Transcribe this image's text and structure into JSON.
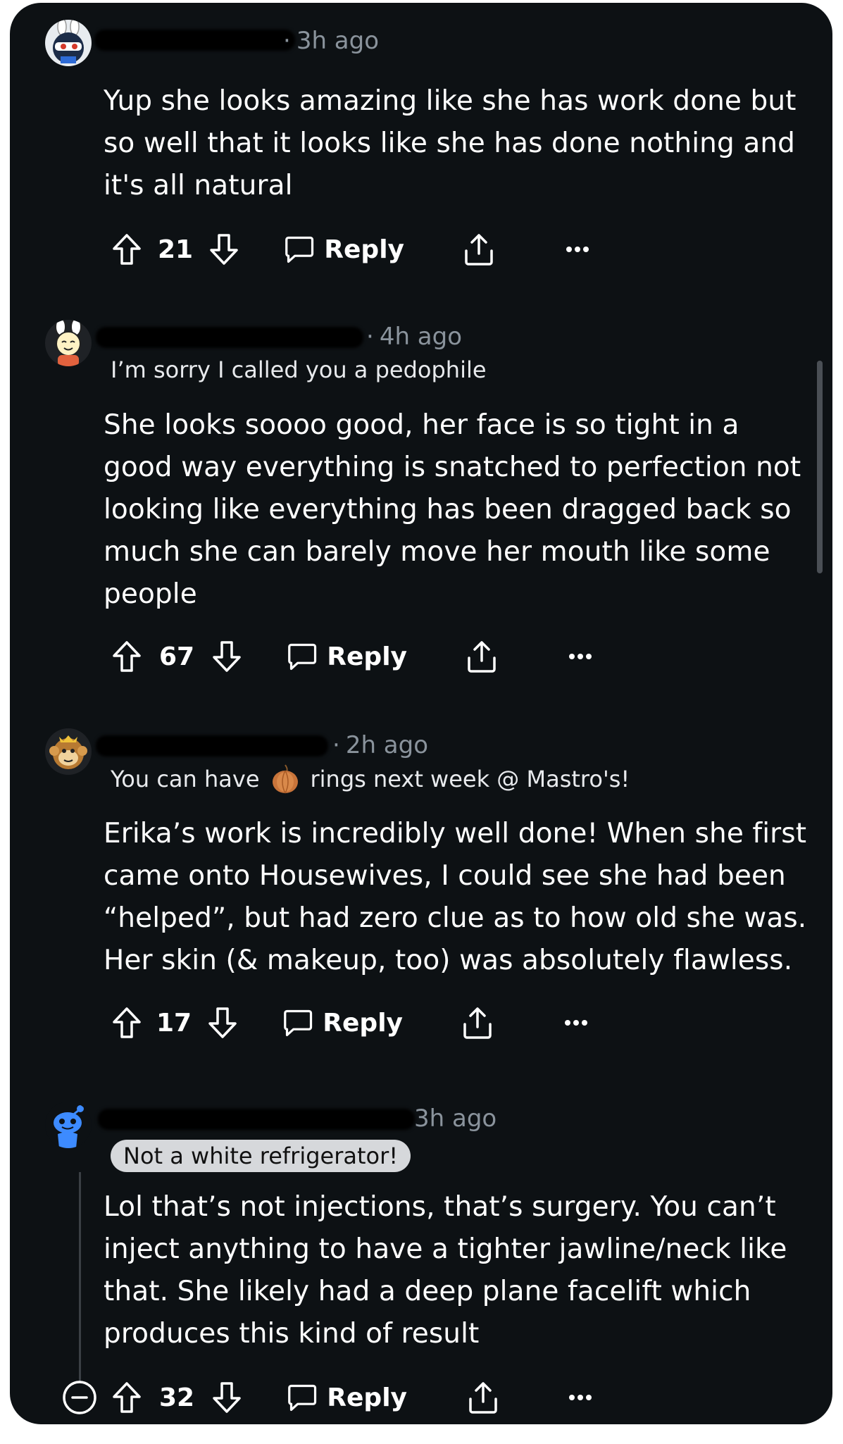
{
  "colors": {
    "background": "#0d1114",
    "text": "#ffffff",
    "meta": "#8a939c",
    "flair_pill_bg": "#d6d8db"
  },
  "comments": [
    {
      "time": "3h ago",
      "flair": "",
      "body": "Yup she looks amazing like she has work done but so well that it looks like she has done nothing and it's all natural",
      "votes": "21",
      "reply_label": "Reply",
      "avatar_icon": "bunny-helmet-avatar"
    },
    {
      "time": "4h ago",
      "flair": "I’m sorry I called you a pedophile",
      "body": "She looks soooo good, her face is so tight in a good way everything is snatched to perfection not looking like everything has been dragged back so much she can barely move her mouth like some people",
      "votes": "67",
      "reply_label": "Reply",
      "avatar_icon": "bunny-ears-avatar"
    },
    {
      "time": "2h ago",
      "flair_before": "You can have",
      "flair_icon": "onion-icon",
      "flair_after": "rings next week @ Mastro's!",
      "body": "Erika’s work is incredibly well done! When she first came onto Housewives, I could see she had been “helped”, but had zero clue as to how old she was. Her skin (& makeup, too) was absolutely flawless.",
      "votes": "17",
      "reply_label": "Reply",
      "avatar_icon": "monkey-avatar"
    },
    {
      "time": "3h ago",
      "flair": "Not a white refrigerator!",
      "body": "Lol that’s not injections, that’s surgery. You can’t inject anything to have a tighter jawline/neck like that. She likely had a deep plane facelift which produces this kind of result",
      "votes": "32",
      "reply_label": "Reply",
      "avatar_icon": "snoo-avatar"
    }
  ]
}
